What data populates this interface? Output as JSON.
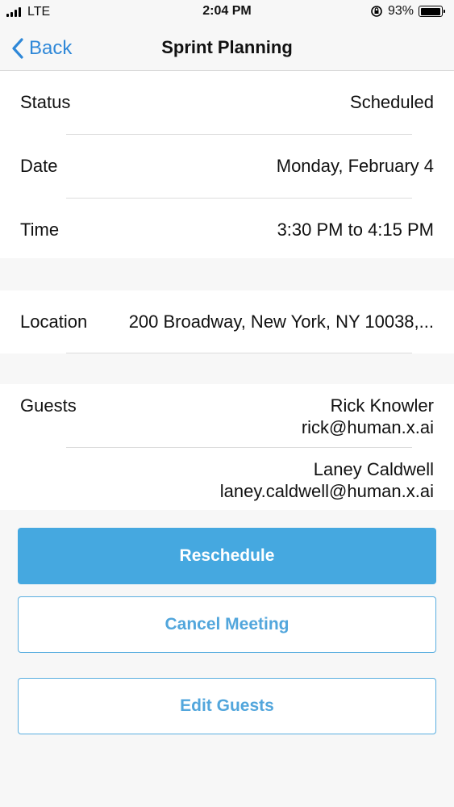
{
  "status_bar": {
    "carrier": "LTE",
    "time": "2:04 PM",
    "battery": "93%"
  },
  "nav": {
    "back_label": "Back",
    "title": "Sprint Planning"
  },
  "details": {
    "status": {
      "label": "Status",
      "value": "Scheduled"
    },
    "date": {
      "label": "Date",
      "value": "Monday, February 4"
    },
    "time": {
      "label": "Time",
      "value": "3:30 PM to 4:15 PM"
    },
    "location": {
      "label": "Location",
      "value": "200 Broadway, New York, NY 10038,..."
    }
  },
  "guests": {
    "label": "Guests",
    "list": [
      {
        "name": "Rick Knowler",
        "email": "rick@human.x.ai"
      },
      {
        "name": "Laney Caldwell",
        "email": "laney.caldwell@human.x.ai"
      }
    ]
  },
  "actions": {
    "reschedule": "Reschedule",
    "cancel": "Cancel Meeting",
    "edit_guests": "Edit Guests"
  }
}
